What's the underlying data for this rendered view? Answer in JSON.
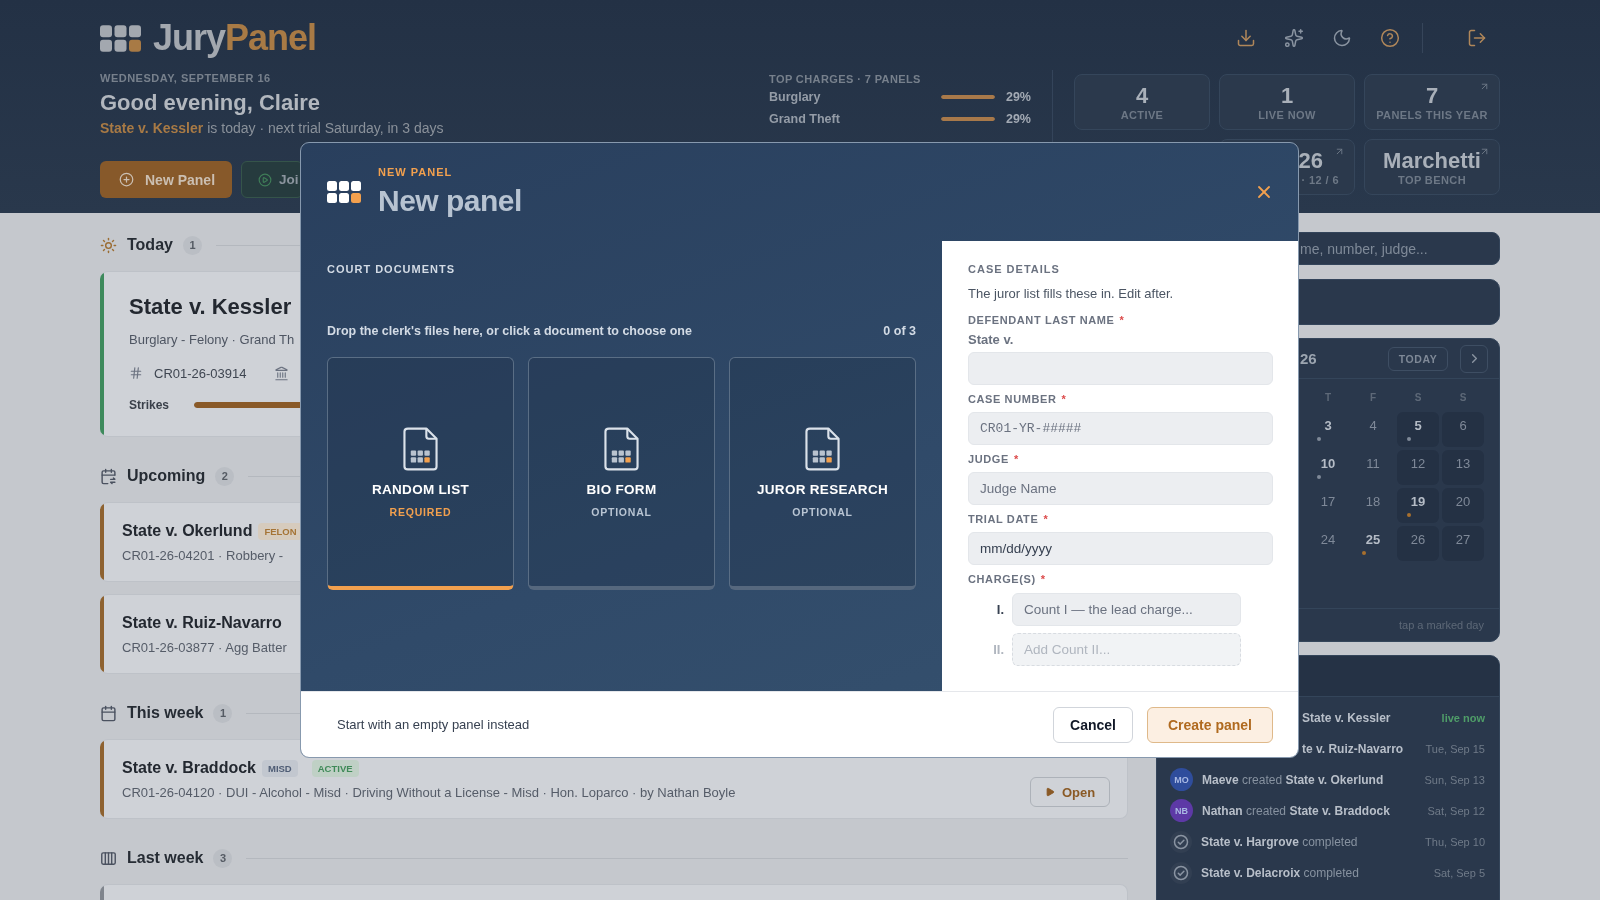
{
  "header": {
    "brand": {
      "name": "Jury",
      "accent": "Panel"
    },
    "date": "WEDNESDAY, SEPTEMBER 16",
    "greeting": "Good evening, Claire",
    "summary": {
      "link": "State v. Kessler",
      "text": "is today · next trial Saturday, in 3 days"
    },
    "buttons": [
      {
        "label": "New Panel",
        "kind": "primary"
      },
      {
        "label": "Joi",
        "kind": "join"
      }
    ]
  },
  "top_charges": {
    "title": "TOP CHARGES · 7 PANELS",
    "rows": [
      {
        "name": "Burglary",
        "level": 1,
        "reading": "29%"
      },
      {
        "name": "Grand Theft",
        "level": 1,
        "reading": "29%"
      }
    ]
  },
  "stats": [
    {
      "value": "4",
      "label": "ACTIVE",
      "linked": false
    },
    {
      "value": "1",
      "label": "LIVE NOW",
      "linked": false
    },
    {
      "value": "7",
      "label": "PANELS THIS YEAR",
      "linked": true
    },
    {
      "value": "26",
      "label": "· 12 / 6",
      "linked": true
    },
    {
      "value": "Marchetti",
      "label": "TOP BENCH",
      "linked": true
    }
  ],
  "sections": [
    {
      "title": "Today",
      "count": "1",
      "cards": [
        {
          "kind": "featured",
          "color": "#3e8a5c",
          "title": "State v. Kessler",
          "charges": "Burglary - Felony · Grand Th",
          "case_number": "CR01-26-03914",
          "strikes": {
            "label": "Strikes",
            "level": 0.45
          }
        }
      ]
    },
    {
      "title": "Upcoming",
      "count": "2",
      "cards": [
        {
          "kind": "compact",
          "color": "#8e6230",
          "title": "State v. Okerlund",
          "tags": [
            {
              "label": "FELON",
              "kind": "felony"
            }
          ],
          "meta": "CR01-26-04201 · Robbery -"
        },
        {
          "kind": "compact",
          "color": "#8e6230",
          "title": "State v. Ruiz-Navarro",
          "meta": "CR01-26-03877 · Agg Batter"
        }
      ]
    },
    {
      "title": "This week",
      "count": "1",
      "cards": [
        {
          "kind": "compact",
          "color": "#8e6230",
          "title": "State v. Braddock",
          "tags": [
            {
              "label": "MISD",
              "kind": "misd"
            },
            {
              "label": "ACTIVE",
              "kind": "active"
            }
          ],
          "meta": "CR01-26-04120 · DUI - Alcohol - Misd · Driving Without a License - Misd · Hon. Loparco · by Nathan Boyle",
          "action": "Open"
        }
      ]
    },
    {
      "title": "Last week",
      "count": "3",
      "cards": [
        {
          "kind": "compact",
          "color": "#80858d"
        }
      ]
    }
  ],
  "search": {
    "placeholder": "me, number, judge..."
  },
  "calendar": {
    "title": "26",
    "today_button": "TODAY",
    "weekdays": [
      "T",
      "F",
      "S",
      "S"
    ],
    "weeks": [
      [
        {
          "day": "3",
          "color": "#7f8998"
        },
        {
          "day": "4"
        },
        {
          "day": "5",
          "color": "#7f8998"
        },
        {
          "day": "6"
        }
      ],
      [
        {
          "day": "10",
          "color": "#7f8998"
        },
        {
          "day": "11"
        },
        {
          "day": "12"
        },
        {
          "day": "13"
        }
      ],
      [
        {
          "day": "17"
        },
        {
          "day": "18"
        },
        {
          "day": "19",
          "color": "#a8702e"
        },
        {
          "day": "20"
        }
      ],
      [
        {
          "day": "24"
        },
        {
          "day": "25",
          "color": "#a8702e"
        },
        {
          "day": "26"
        },
        {
          "day": "27"
        }
      ]
    ],
    "hint": "tap a marked day"
  },
  "activity": {
    "rows": [
      {
        "text": "State v. Kessler",
        "date": "live now",
        "live": true
      },
      {
        "text": "te v. Ruiz-Navarro",
        "date": "Tue, Sep 15",
        "live": false
      },
      {
        "kind": "avatar",
        "initials": "MO",
        "color": "#2f4d9c",
        "text": "**Maeve** created **State v. Okerlund**",
        "date": "Sun, Sep 13",
        "live": false
      },
      {
        "kind": "avatar",
        "initials": "NB",
        "color": "#5d39a6",
        "text": "**Nathan** created **State v. Braddock**",
        "date": "Sat, Sep 12",
        "live": false
      },
      {
        "kind": "check",
        "text": "**State v. Hargrove** completed",
        "date": "Thu, Sep 10",
        "live": false
      },
      {
        "kind": "check",
        "text": "**State v. Delacroix** completed",
        "date": "Sat, Sep 5",
        "live": false
      }
    ]
  },
  "dialog": {
    "eyebrow": "NEW PANEL",
    "title": "New panel",
    "documents": {
      "title": "COURT DOCUMENTS",
      "hint": "Drop the clerk's files here, or click a document to choose one",
      "count": "0 of 3",
      "items": [
        {
          "name": "RANDOM LIST",
          "tag": "REQUIRED",
          "required": true
        },
        {
          "name": "BIO FORM",
          "tag": "OPTIONAL",
          "required": false
        },
        {
          "name": "JUROR RESEARCH",
          "tag": "OPTIONAL",
          "required": false
        }
      ]
    },
    "details": {
      "title": "CASE DETAILS",
      "hint": "The juror list fills these in. Edit after.",
      "fields": [
        {
          "label": "DEFENDANT LAST NAME",
          "required_mark": "*",
          "prefix": "State v.",
          "kind": "text"
        },
        {
          "label": "CASE NUMBER",
          "required_mark": "*",
          "placeholder": "CR01-YR-#####",
          "kind": "code"
        },
        {
          "label": "JUDGE",
          "required_mark": "*",
          "placeholder": "Judge Name",
          "kind": "text"
        },
        {
          "label": "TRIAL DATE",
          "required_mark": "*",
          "placeholder": "mm/dd/yyyy",
          "kind": "date"
        }
      ],
      "charges": {
        "label": "CHARGE(S)",
        "required_mark": "*",
        "counts": [
          {
            "numeral": "I.",
            "placeholder": "Count I — the lead charge...",
            "kind": "count"
          },
          {
            "numeral": "II.",
            "placeholder": "Add Count II...",
            "kind": "add"
          }
        ]
      }
    },
    "footer": {
      "alternative": "Start with an empty panel instead",
      "buttons": [
        {
          "label": "Cancel",
          "kind": "secondary"
        },
        {
          "label": "Create panel",
          "kind": "primary"
        }
      ]
    }
  }
}
